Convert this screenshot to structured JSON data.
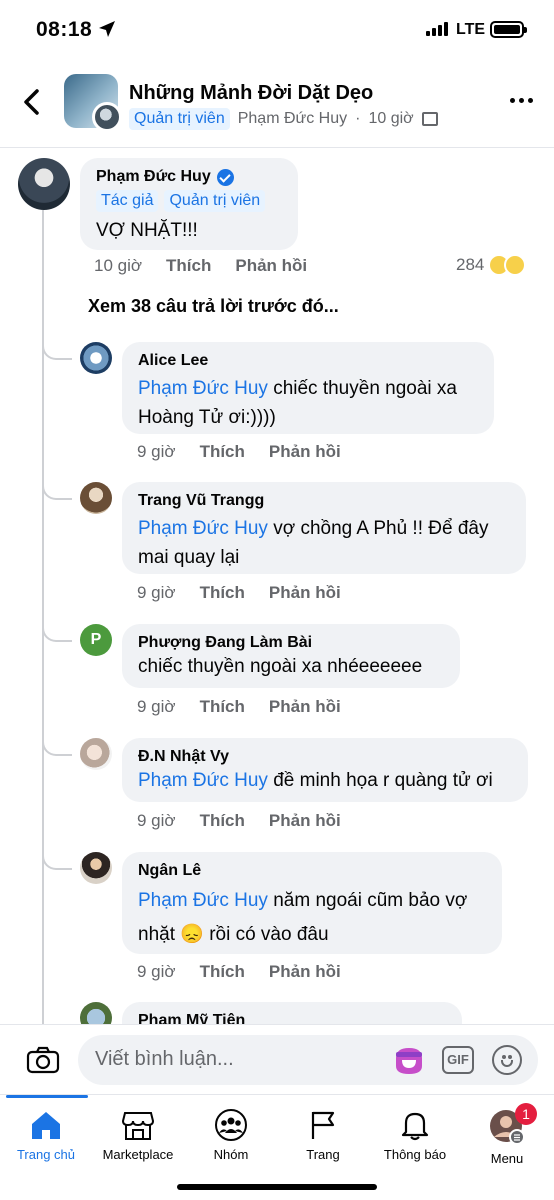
{
  "status_bar": {
    "time": "08:18",
    "network": "LTE"
  },
  "header": {
    "title": "Những Mảnh Đời Dặt Dẹo",
    "role_badge": "Quản trị viên",
    "author": "Phạm Đức Huy",
    "separator": "·",
    "time": "10 giờ"
  },
  "root_comment": {
    "author": "Phạm Đức Huy",
    "badges": [
      "Tác giả",
      "Quản trị viên"
    ],
    "text": "VỢ NHẶT!!!",
    "time": "10 giờ",
    "like_label": "Thích",
    "reply_label": "Phản hồi",
    "reaction_count": "284"
  },
  "view_previous": "Xem 38 câu trả lời trước đó...",
  "replies": [
    {
      "author": "Alice Lee",
      "mention": "Phạm Đức Huy",
      "text": " chiếc thuyền ngoài xa Hoàng Tử ơi:))))",
      "time": "9 giờ",
      "like_label": "Thích",
      "reply_label": "Phản hồi"
    },
    {
      "author": "Trang Vũ Trangg",
      "mention": "Phạm Đức Huy",
      "text": " vợ chồng A Phủ !! Để đây mai quay lại",
      "time": "9 giờ",
      "like_label": "Thích",
      "reply_label": "Phản hồi"
    },
    {
      "author": "Phượng Đang Làm Bài",
      "avatar_letter": "P",
      "mention": "",
      "text": "chiếc thuyền ngoài xa nhéeeeeee",
      "time": "9 giờ",
      "like_label": "Thích",
      "reply_label": "Phản hồi"
    },
    {
      "author": "Đ.N Nhật Vy",
      "mention": "Phạm Đức Huy",
      "text": " đề minh họa r quàng tử ơi",
      "time": "9 giờ",
      "like_label": "Thích",
      "reply_label": "Phản hồi"
    },
    {
      "author": "Ngân Lê",
      "mention": "Phạm Đức Huy",
      "text": " năm ngoái cũm bảo vợ nhặt 😞 rồi có vào đâu",
      "time": "9 giờ",
      "like_label": "Thích",
      "reply_label": "Phản hồi"
    },
    {
      "author": "Phạm Mỹ Tiên"
    }
  ],
  "composer": {
    "placeholder": "Viết bình luận...",
    "gif_label": "GIF"
  },
  "tabs": [
    {
      "label": "Trang chủ",
      "icon": "home-icon",
      "active": true
    },
    {
      "label": "Marketplace",
      "icon": "marketplace-icon"
    },
    {
      "label": "Nhóm",
      "icon": "groups-icon"
    },
    {
      "label": "Trang",
      "icon": "flag-icon"
    },
    {
      "label": "Thông báo",
      "icon": "bell-icon"
    },
    {
      "label": "Menu",
      "icon": "profile-menu-icon",
      "badge": "1"
    }
  ],
  "colors": {
    "accent": "#1b74e4",
    "bubble": "#f0f2f5",
    "muted": "#65676b",
    "notification": "#e41e3f"
  }
}
